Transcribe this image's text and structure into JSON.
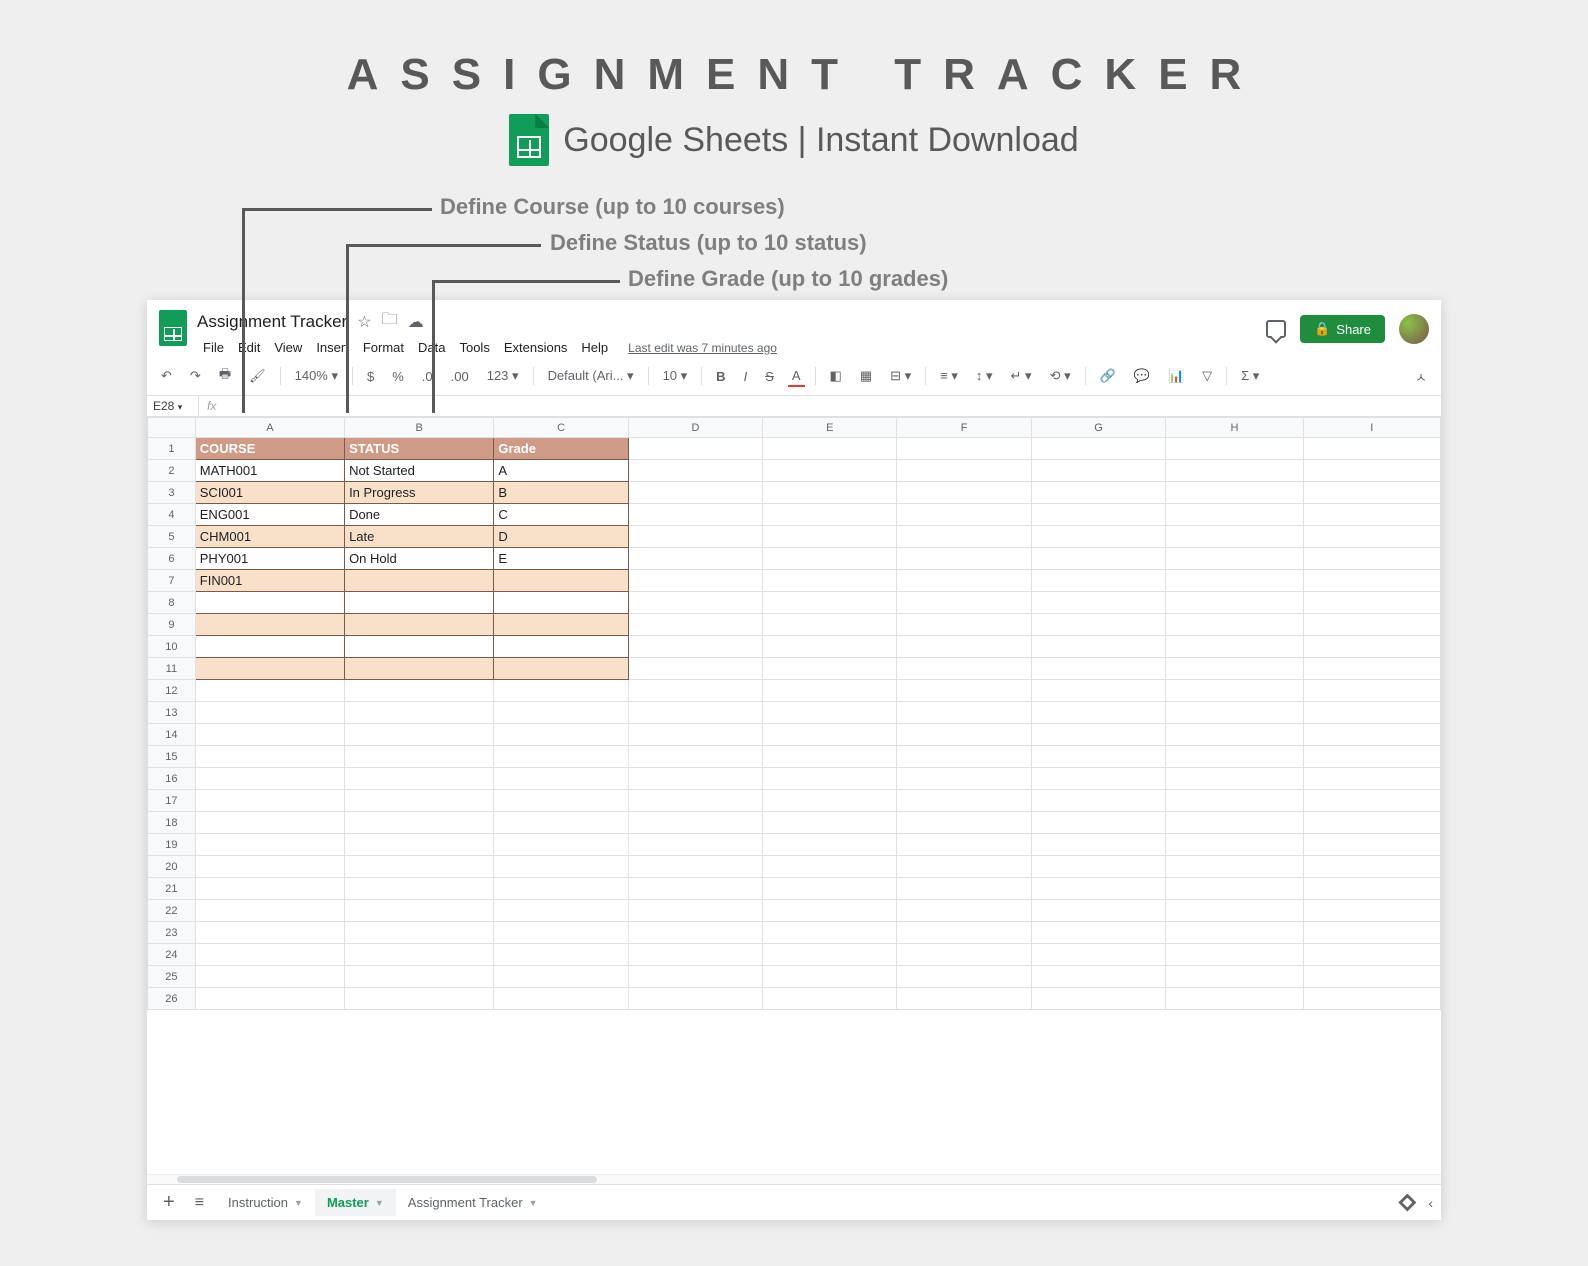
{
  "hero": {
    "title": "ASSIGNMENT TRACKER",
    "subtitle": "Google Sheets | Instant Download"
  },
  "callouts": {
    "course": "Define Course  (up to 10 courses)",
    "status": "Define Status  (up to 10 status)",
    "grade": "Define Grade (up to 10 grades)"
  },
  "doc": {
    "title": "Assignment Tracker",
    "lastEdit": "Last edit was 7 minutes ago",
    "shareLabel": "Share"
  },
  "menu": [
    "File",
    "Edit",
    "View",
    "Insert",
    "Format",
    "Data",
    "Tools",
    "Extensions",
    "Help"
  ],
  "toolbar": {
    "zoom": "140%",
    "font": "Default (Ari...",
    "size": "10",
    "currency": "$",
    "percent": "%",
    "dec1": ".0",
    "dec2": ".00",
    "fmt": "123"
  },
  "namebox": {
    "ref": "E28"
  },
  "columns": [
    "",
    "A",
    "B",
    "C",
    "D",
    "E",
    "F",
    "G",
    "H",
    "I"
  ],
  "headers": {
    "course": "COURSE",
    "status": "STATUS",
    "grade": "Grade"
  },
  "data": [
    {
      "course": "MATH001",
      "status": "Not Started",
      "grade": "A"
    },
    {
      "course": "SCI001",
      "status": "In Progress",
      "grade": "B"
    },
    {
      "course": "ENG001",
      "status": "Done",
      "grade": "C"
    },
    {
      "course": "CHM001",
      "status": "Late",
      "grade": "D"
    },
    {
      "course": "PHY001",
      "status": "On Hold",
      "grade": "E"
    },
    {
      "course": "FIN001",
      "status": "",
      "grade": ""
    },
    {
      "course": "",
      "status": "",
      "grade": ""
    },
    {
      "course": "",
      "status": "",
      "grade": ""
    },
    {
      "course": "",
      "status": "",
      "grade": ""
    },
    {
      "course": "",
      "status": "",
      "grade": ""
    }
  ],
  "tabs": [
    {
      "label": "Instruction",
      "active": false
    },
    {
      "label": "Master",
      "active": true
    },
    {
      "label": "Assignment Tracker",
      "active": false
    }
  ],
  "extraRows": 15
}
